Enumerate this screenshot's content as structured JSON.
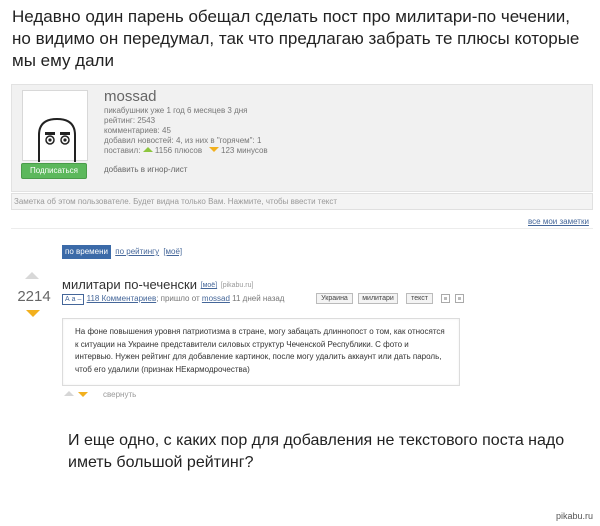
{
  "intro_text": "Недавно один парень обещал сделать пост про милитари-по чечении, но видимо он передумал, так что предлагаю забрать те плюсы которые мы ему дали",
  "profile": {
    "username": "mossad",
    "stats": [
      "пикабушник уже 1 год 6 месяцев 3 дня",
      "рейтинг: 2543",
      "комментариев: 45",
      "добавил новостей: 4, из них в \"горячем\": 1"
    ],
    "posted_label": "поставил:",
    "pluses": "1156 плюсов",
    "minuses": "123 минусов",
    "subscribe_label": "Подписаться",
    "ignore_label": "добавить в игнор-лист",
    "note_placeholder": "Заметка об этом пользователе. Будет видна только Вам. Нажмите, чтобы ввести текст",
    "all_notes_label": "все мои заметки"
  },
  "sort": {
    "by_time": "по времени",
    "by_rating": "по рейтингу",
    "mine": "[моё]"
  },
  "post": {
    "score": "2214",
    "title": "милитари по-чеченски",
    "mine_tag": "[моё]",
    "source": "[pikabu.ru]",
    "font_toggle": "А а –",
    "comments_link": "118 Комментариев",
    "posted_prefix": "; пришло от",
    "author": "mossad",
    "time_ago": "11 дней назад",
    "tags": [
      "Украина",
      "милитари",
      "текст"
    ],
    "comment_text": "На фоне повышения уровня патриотизма в стране, могу забацать длиннопост о том, как относятся к ситуации на Украине представители силовых структур Чеченской Республики. С фото и интервью. Нужен рейтинг для добавление картинок, после могу удалить аккаунт или дать пароль, чтоб его удалили (признак НЕкармодрочества)",
    "collapse_label": "свернуть"
  },
  "outro_text": "И еще одно, с каких пор для добавления не текстового поста надо иметь большой рейтинг?",
  "watermark": "pikabu.ru",
  "colors": {
    "subscribe_green": "#5cb85c",
    "link_blue": "#446699",
    "sort_active": "#3b6aa8",
    "minus_orange": "#f2b01e",
    "plus_green": "#8dc63f"
  }
}
